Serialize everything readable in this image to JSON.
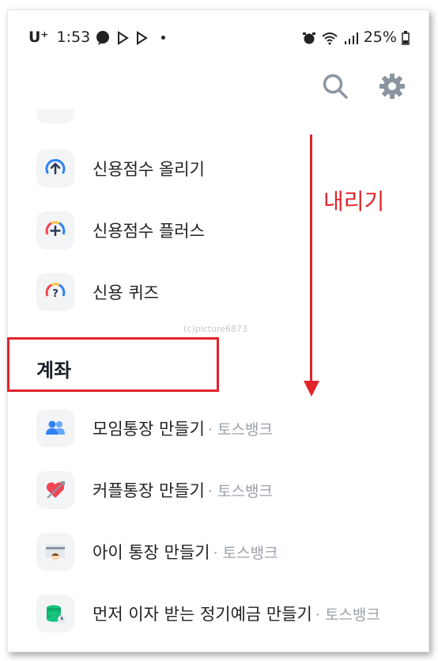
{
  "status_bar": {
    "carrier": "U⁺",
    "time": "1:53",
    "battery": "25%"
  },
  "toolbar": {
    "search_icon": "search-icon",
    "settings_icon": "gear-icon"
  },
  "credit_items": [
    {
      "label": "신용점수 올리기",
      "icon": "score-up-icon"
    },
    {
      "label": "신용점수 플러스",
      "icon": "score-plus-icon"
    },
    {
      "label": "신용 퀴즈",
      "icon": "score-quiz-icon"
    }
  ],
  "account_section": {
    "title": "계좌",
    "items": [
      {
        "label": "모임통장 만들기",
        "sub": "· 토스뱅크",
        "icon": "group-people-icon"
      },
      {
        "label": "커플통장 만들기",
        "sub": "· 토스뱅크",
        "icon": "heart-arrow-icon"
      },
      {
        "label": "아이 통장 만들기",
        "sub": "· 토스뱅크",
        "icon": "child-card-icon"
      },
      {
        "label": "먼저 이자 받는 정기예금 만들기",
        "sub": "· 토스뱅크",
        "icon": "coin-stack-icon"
      }
    ]
  },
  "annotation": {
    "scroll_text": "내리기",
    "watermark": "(c)picture6873",
    "color": "#e1242a"
  }
}
